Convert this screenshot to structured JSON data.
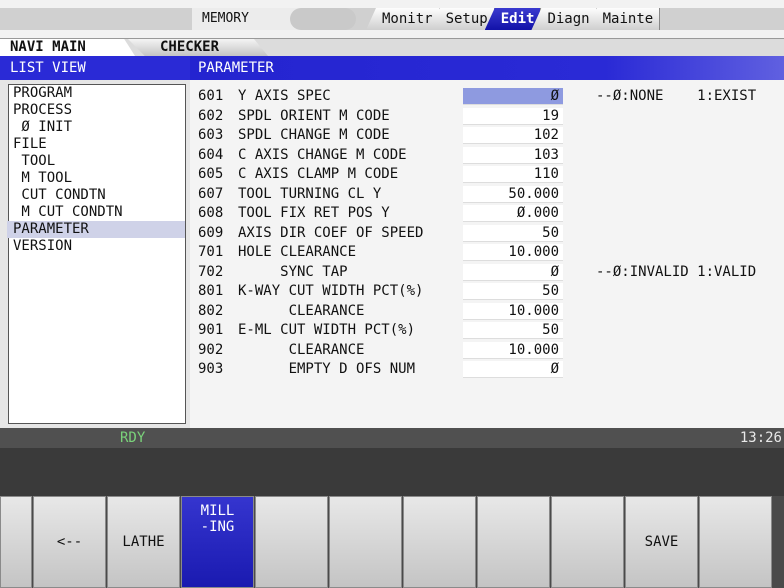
{
  "header": {
    "memory_label": "MEMORY",
    "mode_tabs": [
      "Monitr",
      "Setup",
      "Edit",
      "Diagn",
      "Mainte"
    ],
    "active_mode": "Edit"
  },
  "tabs": {
    "navi_main": "NAVI MAIN",
    "checker": "CHECKER"
  },
  "list_view": {
    "title": "LIST VIEW",
    "items": [
      "PROGRAM",
      "PROCESS",
      " Ø INIT",
      "FILE",
      " TOOL",
      " M TOOL",
      " CUT CONDTN",
      " M CUT CONDTN",
      "PARAMETER",
      "VERSION"
    ],
    "selected": "PARAMETER"
  },
  "parameter": {
    "title": "PARAMETER",
    "rows": [
      {
        "num": "601",
        "name": "Y AXIS SPEC",
        "value": "Ø",
        "note": "--Ø:NONE    1:EXIST"
      },
      {
        "num": "602",
        "name": "SPDL ORIENT M CODE",
        "value": "19",
        "note": ""
      },
      {
        "num": "603",
        "name": "SPDL CHANGE M CODE",
        "value": "102",
        "note": ""
      },
      {
        "num": "604",
        "name": "C AXIS CHANGE M CODE",
        "value": "103",
        "note": ""
      },
      {
        "num": "605",
        "name": "C AXIS CLAMP M CODE",
        "value": "110",
        "note": ""
      },
      {
        "num": "607",
        "name": "TOOL TURNING CL Y",
        "value": "50.000",
        "note": ""
      },
      {
        "num": "608",
        "name": "TOOL FIX RET POS Y",
        "value": "Ø.000",
        "note": ""
      },
      {
        "num": "609",
        "name": "AXIS DIR COEF OF SPEED",
        "value": "50",
        "note": ""
      },
      {
        "num": "701",
        "name": "HOLE CLEARANCE",
        "value": "10.000",
        "note": ""
      },
      {
        "num": "702",
        "name": "     SYNC TAP",
        "value": "Ø",
        "note": "--Ø:INVALID 1:VALID"
      },
      {
        "num": "801",
        "name": "K-WAY CUT WIDTH PCT(%)",
        "value": "50",
        "note": ""
      },
      {
        "num": "802",
        "name": "      CLEARANCE",
        "value": "10.000",
        "note": ""
      },
      {
        "num": "901",
        "name": "E-ML CUT WIDTH PCT(%)",
        "value": "50",
        "note": ""
      },
      {
        "num": "902",
        "name": "      CLEARANCE",
        "value": "10.000",
        "note": ""
      },
      {
        "num": "903",
        "name": "      EMPTY D OFS NUM",
        "value": "Ø",
        "note": ""
      }
    ],
    "input_value": ""
  },
  "icons": [
    "navi-icon",
    "info-icon",
    "help-icon"
  ],
  "status": {
    "ready": "RDY",
    "time": "13:26"
  },
  "fkeys": [
    "",
    "<--",
    "LATHE",
    "MILL\n-ING",
    "",
    "",
    "",
    "",
    "",
    "SAVE",
    ""
  ],
  "active_fkey": "MILL\n-ING"
}
